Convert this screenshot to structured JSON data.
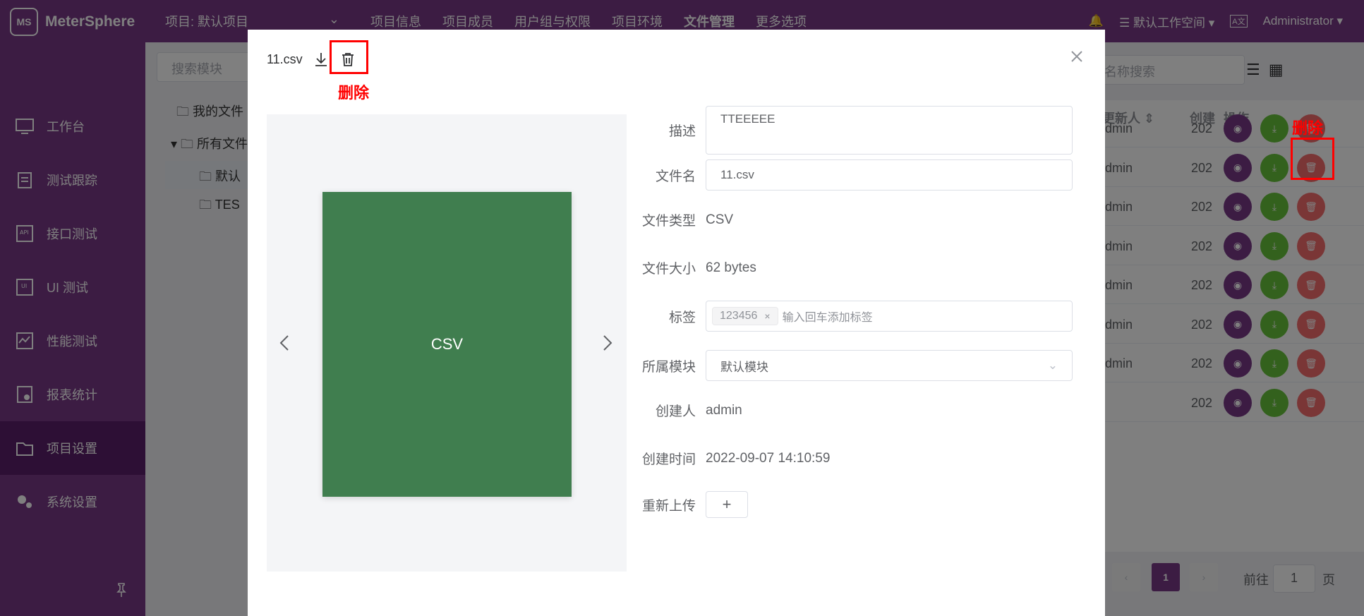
{
  "app": {
    "name": "MeterSphere",
    "logo_mark": "MS"
  },
  "header": {
    "project": "项目: 默认项目",
    "nav": [
      "项目信息",
      "项目成员",
      "用户组与权限",
      "项目环境",
      "文件管理",
      "更多选项"
    ],
    "workspace": "默认工作空间",
    "user": "Administrator",
    "lang_badge": "A文"
  },
  "sidebar": {
    "items": [
      {
        "label": "工作台",
        "icon": "monitor-icon"
      },
      {
        "label": "测试跟踪",
        "icon": "clipboard-icon"
      },
      {
        "label": "接口测试",
        "icon": "api-icon"
      },
      {
        "label": "UI 测试",
        "icon": "ui-icon"
      },
      {
        "label": "性能测试",
        "icon": "chart-icon"
      },
      {
        "label": "报表统计",
        "icon": "report-icon"
      },
      {
        "label": "项目设置",
        "icon": "folder-gear-icon"
      },
      {
        "label": "系统设置",
        "icon": "gears-icon"
      }
    ],
    "active_index": 6
  },
  "background": {
    "search_placeholder": "搜索模块",
    "tree": [
      "我的文件",
      "所有文件",
      "默认",
      "TES"
    ],
    "name_search_placeholder": "名称搜索",
    "columns": {
      "updater": "更新人",
      "created": "创建",
      "ops": "操作"
    },
    "rows": [
      {
        "updater": "dmin",
        "created": "202"
      },
      {
        "updater": "dmin",
        "created": "202"
      },
      {
        "updater": "dmin",
        "created": "202"
      },
      {
        "updater": "dmin",
        "created": "202"
      },
      {
        "updater": "dmin",
        "created": "202"
      },
      {
        "updater": "dmin",
        "created": "202"
      },
      {
        "updater": "dmin",
        "created": "202"
      },
      {
        "updater": "",
        "created": "202"
      }
    ],
    "pager": {
      "current": "1",
      "goto_label": "前往",
      "goto_value": "1",
      "page_suffix": "页"
    }
  },
  "annotations": {
    "delete_label_dialog": "删除",
    "delete_label_table": "删除"
  },
  "dialog": {
    "title": "11.csv",
    "preview_text": "CSV",
    "fields": {
      "desc_label": "描述",
      "desc_value": "TTEEEEE",
      "name_label": "文件名",
      "name_value": "11.csv",
      "type_label": "文件类型",
      "type_value": "CSV",
      "size_label": "文件大小",
      "size_value": "62 bytes",
      "tags_label": "标签",
      "tag_item": "123456",
      "tag_placeholder": "输入回车添加标签",
      "module_label": "所属模块",
      "module_value": "默认模块",
      "creator_label": "创建人",
      "creator_value": "admin",
      "time_label": "创建时间",
      "time_value": "2022-09-07 14:10:59",
      "reupload_label": "重新上传"
    }
  },
  "colors": {
    "brand": "#783887",
    "preview_card": "#407e4f",
    "annotation": "#ff0000"
  }
}
